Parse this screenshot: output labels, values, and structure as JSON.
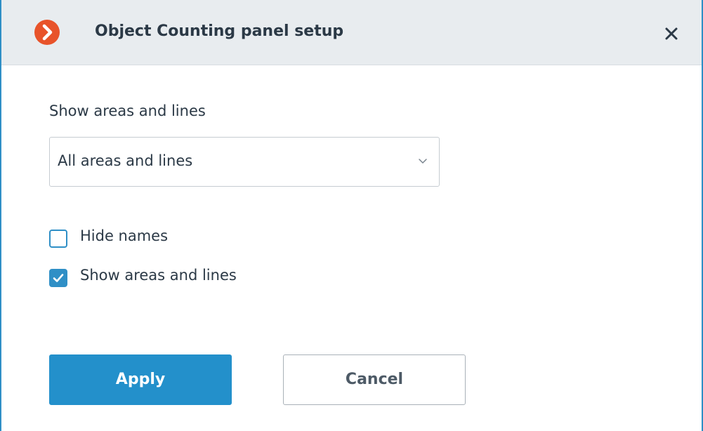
{
  "dialog": {
    "title": "Object Counting panel setup",
    "logo_icon": "app-logo-icon",
    "close_icon": "close-icon"
  },
  "areas": {
    "label": "Show areas and lines",
    "select_value": "All areas and lines",
    "chevron_icon": "chevron-down-icon"
  },
  "options": {
    "hide_names": {
      "label": "Hide names",
      "checked": false
    },
    "show_areas": {
      "label": "Show areas and lines",
      "checked": true
    }
  },
  "buttons": {
    "apply_label": "Apply",
    "cancel_label": "Cancel"
  },
  "colors": {
    "accent": "#2390cb",
    "logo": "#e8532a",
    "titlebar_bg": "#e8ecef"
  }
}
